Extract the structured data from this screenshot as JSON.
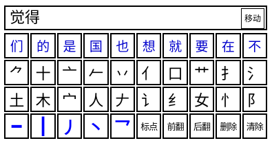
{
  "input": {
    "composition": "觉得",
    "move_label": "移动"
  },
  "candidates": [
    "们",
    "的",
    "是",
    "国",
    "也",
    "想",
    "就",
    "要",
    "在",
    "不"
  ],
  "components": {
    "row1": [
      "⺈",
      "十",
      "亠",
      "𠂉",
      "丷",
      "亻",
      "口",
      "艹",
      "扌",
      "氵"
    ],
    "row2": [
      "土",
      "木",
      "宀",
      "人",
      "𠂇",
      "讠",
      "纟",
      "女",
      "忄",
      "阝"
    ]
  },
  "strokes": [
    "━",
    "┃",
    "丿",
    "丶",
    "乛"
  ],
  "functions": {
    "punctuation": "标点",
    "prev_page": "前翻",
    "next_page": "后翻",
    "delete": "删除",
    "clear": "清除"
  }
}
